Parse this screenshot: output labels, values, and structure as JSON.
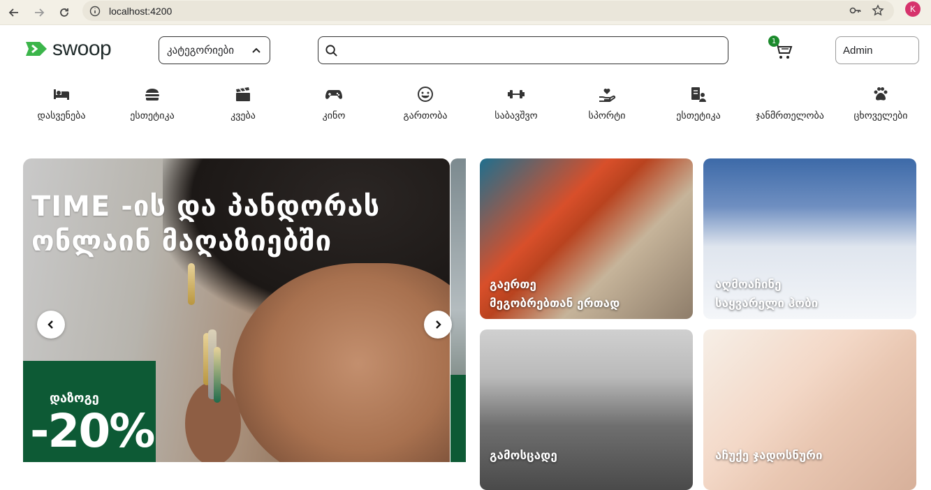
{
  "browser": {
    "url": "localhost:4200",
    "profile_initial": "K"
  },
  "header": {
    "logo_text": "swoop",
    "categories_button": "კატეგორიები",
    "search_placeholder": "",
    "cart_count": "1",
    "admin_label": "Admin"
  },
  "categories": [
    {
      "label": "დასვენება",
      "icon": "bed-icon"
    },
    {
      "label": "ესთეტიკა",
      "icon": "burger-icon"
    },
    {
      "label": "კვება",
      "icon": "clapperboard-icon"
    },
    {
      "label": "კინო",
      "icon": "gamepad-icon"
    },
    {
      "label": "გართობა",
      "icon": "smile-icon"
    },
    {
      "label": "საბავშვო",
      "icon": "dumbbell-icon"
    },
    {
      "label": "სპორტი",
      "icon": "hand-heart-icon"
    },
    {
      "label": "ესთეტიკა",
      "icon": "user-card-icon"
    },
    {
      "label": "ჯანმრთელობა",
      "icon": "paw-icon"
    },
    {
      "label": "ცხოველები",
      "icon": "paw-icon"
    }
  ],
  "hero": {
    "headline_line1": "TIME -ის და პანდორას",
    "headline_line2": "ონლაინ მაღაზიებში",
    "discount_label": "დაზოგე",
    "discount_value": "-20%"
  },
  "tiles": [
    {
      "line1": "გაერთე",
      "line2": "მეგობრებთან ერთად"
    },
    {
      "line1": "აღმოაჩინე",
      "line2": "საყვარელი ჰობი"
    },
    {
      "line1": "გამოსცადე",
      "line2": ""
    },
    {
      "line1": "აჩუქე ჯადოსნური",
      "line2": ""
    }
  ],
  "colors": {
    "brand_green": "#3bb54a",
    "badge_green": "#1b8a2c",
    "hero_green": "#0d5a35"
  }
}
